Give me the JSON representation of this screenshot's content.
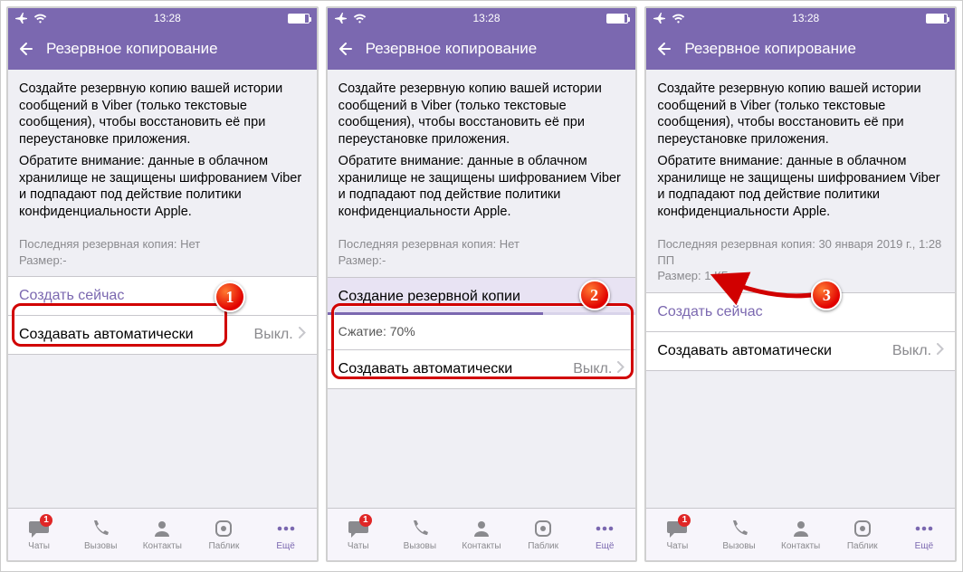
{
  "statusbar": {
    "time": "13:28"
  },
  "header": {
    "title": "Резервное копирование"
  },
  "desc": {
    "p1": "Создайте резервную копию вашей истории сообщений в Viber (только текстовые сообщения), чтобы восстановить её при переустановке приложения.",
    "p2": "Обратите внимание: данные в облачном хранилище не защищены шифрованием Viber и подпадают под действие политики конфиденциальности Apple."
  },
  "screen1": {
    "last_backup_line": "Последняя резервная копия: Нет",
    "size_line": "Размер:-",
    "backup_now": "Создать сейчас",
    "auto_label": "Создавать автоматически",
    "auto_value": "Выкл."
  },
  "screen2": {
    "last_backup_line": "Последняя резервная копия: Нет",
    "size_line": "Размер:-",
    "progress_title": "Создание резервной копии",
    "progress_sub": "Сжатие: 70%",
    "auto_label": "Создавать автоматически",
    "auto_value": "Выкл."
  },
  "screen3": {
    "last_backup_line": "Последняя резервная копия: 30 января 2019 г., 1:28 ПП",
    "size_line": "Размер: 1 КБ",
    "backup_now": "Создать сейчас",
    "auto_label": "Создавать автоматически",
    "auto_value": "Выкл."
  },
  "tabs": {
    "chats": "Чаты",
    "calls": "Вызовы",
    "contacts": "Контакты",
    "public": "Паблик",
    "more": "Ещё",
    "badge": "1"
  },
  "callouts": {
    "c1": "1",
    "c2": "2",
    "c3": "3"
  }
}
